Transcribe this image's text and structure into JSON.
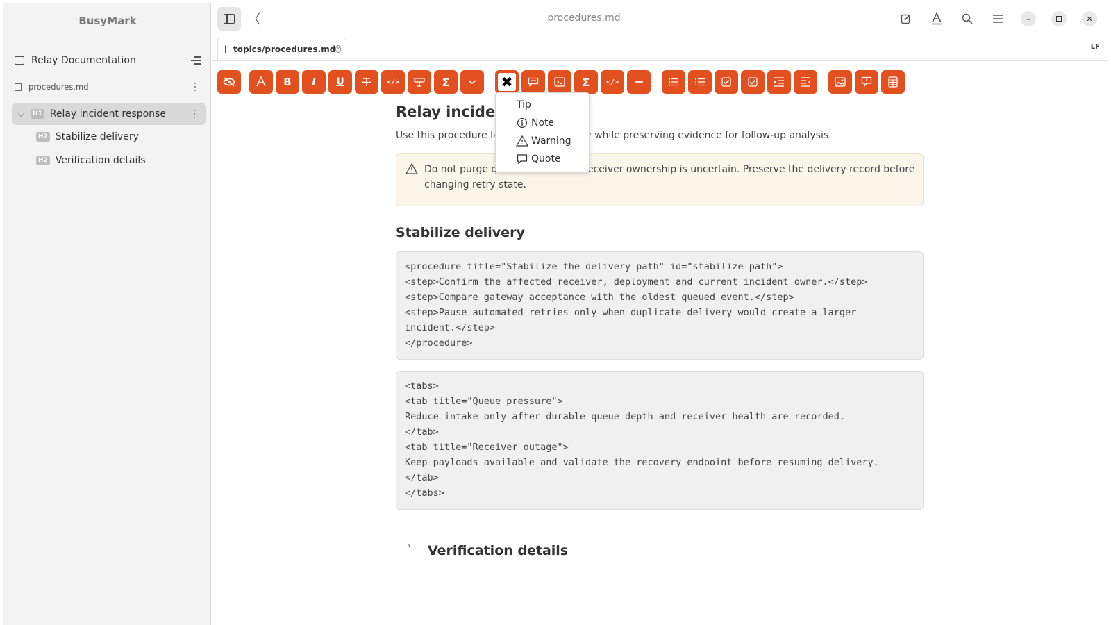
{
  "app": {
    "name": "BusyMark",
    "window_title": "procedures.md"
  },
  "sidebar": {
    "project": "Relay Documentation",
    "file": "procedures.md",
    "outline": [
      {
        "level": "H1",
        "label": "Relay incident response",
        "expanded": true,
        "active": true
      },
      {
        "level": "H2",
        "label": "Stabilize delivery"
      },
      {
        "level": "H2",
        "label": "Verification details"
      }
    ]
  },
  "tabs": [
    {
      "label": "topics/procedures.md"
    }
  ],
  "line_ending": "LF",
  "toolbar": [
    {
      "name": "preview-toggle",
      "icon": "eye-slash-icon"
    },
    {
      "name": "heading",
      "icon": "font-icon"
    },
    {
      "name": "bold",
      "icon": "bold-icon",
      "glyph": "B"
    },
    {
      "name": "italic",
      "icon": "italic-icon",
      "glyph": "I"
    },
    {
      "name": "underline",
      "icon": "underline-icon",
      "glyph": "U"
    },
    {
      "name": "strikethrough",
      "icon": "strikethrough-icon"
    },
    {
      "name": "inline-code",
      "icon": "code-icon"
    },
    {
      "name": "highlight",
      "icon": "marker-icon"
    },
    {
      "name": "inline-math",
      "icon": "sigma-icon"
    },
    {
      "name": "more",
      "icon": "chevron-down-icon"
    },
    {
      "name": "admonition",
      "icon": "close-icon",
      "active": true
    },
    {
      "name": "comment",
      "icon": "comment-icon"
    },
    {
      "name": "terminal",
      "icon": "terminal-icon"
    },
    {
      "name": "math-block",
      "icon": "sigma-icon"
    },
    {
      "name": "code-block",
      "icon": "code-icon"
    },
    {
      "name": "horizontal-rule",
      "icon": "minus-icon"
    },
    {
      "name": "bullet-list",
      "icon": "list-icon"
    },
    {
      "name": "numbered-list",
      "icon": "numbered-list-icon"
    },
    {
      "name": "task-list",
      "icon": "checkbox-icon"
    },
    {
      "name": "task-list-checked",
      "icon": "checkbox-icon"
    },
    {
      "name": "indent",
      "icon": "indent-icon"
    },
    {
      "name": "outdent",
      "icon": "outdent-icon"
    },
    {
      "name": "image",
      "icon": "image-icon"
    },
    {
      "name": "insert-tip",
      "icon": "message-icon"
    },
    {
      "name": "table",
      "icon": "table-icon"
    }
  ],
  "dropdown": {
    "items": [
      {
        "label": "Tip",
        "icon": ""
      },
      {
        "label": "Note",
        "icon": "info-icon"
      },
      {
        "label": "Warning",
        "icon": "warning-icon"
      },
      {
        "label": "Quote",
        "icon": "quote-icon"
      }
    ]
  },
  "document": {
    "h1_visible": "Relay inciden",
    "para_head": "Use this procedure to",
    "para_tail": "ery while preserving evidence for follow-up analysis.",
    "callout": {
      "line1_head": "Do not purge qu",
      "line1_tail": "eceiver ownership is uncertain. Preserve the delivery record before",
      "line2": "changing retry state."
    },
    "h2_stabilize": "Stabilize delivery",
    "code1": "<procedure title=\"Stabilize the delivery path\" id=\"stabilize-path\">\n<step>Confirm the affected receiver, deployment and current incident owner.</step>\n<step>Compare gateway acceptance with the oldest queued event.</step>\n<step>Pause automated retries only when duplicate delivery would create a larger\nincident.</step>\n</procedure>",
    "code2": "<tabs>\n<tab title=\"Queue pressure\">\nReduce intake only after durable queue depth and receiver health are recorded.\n</tab>\n<tab title=\"Receiver outage\">\nKeep payloads available and validate the recovery endpoint before resuming delivery.\n</tab>\n</tabs>",
    "h2_verification": "Verification details"
  },
  "colors": {
    "accent": "#e2501f",
    "sidebar_bg": "#f3f3f3",
    "code_bg": "#f0f0f0",
    "callout_bg": "#fbf5ea"
  }
}
